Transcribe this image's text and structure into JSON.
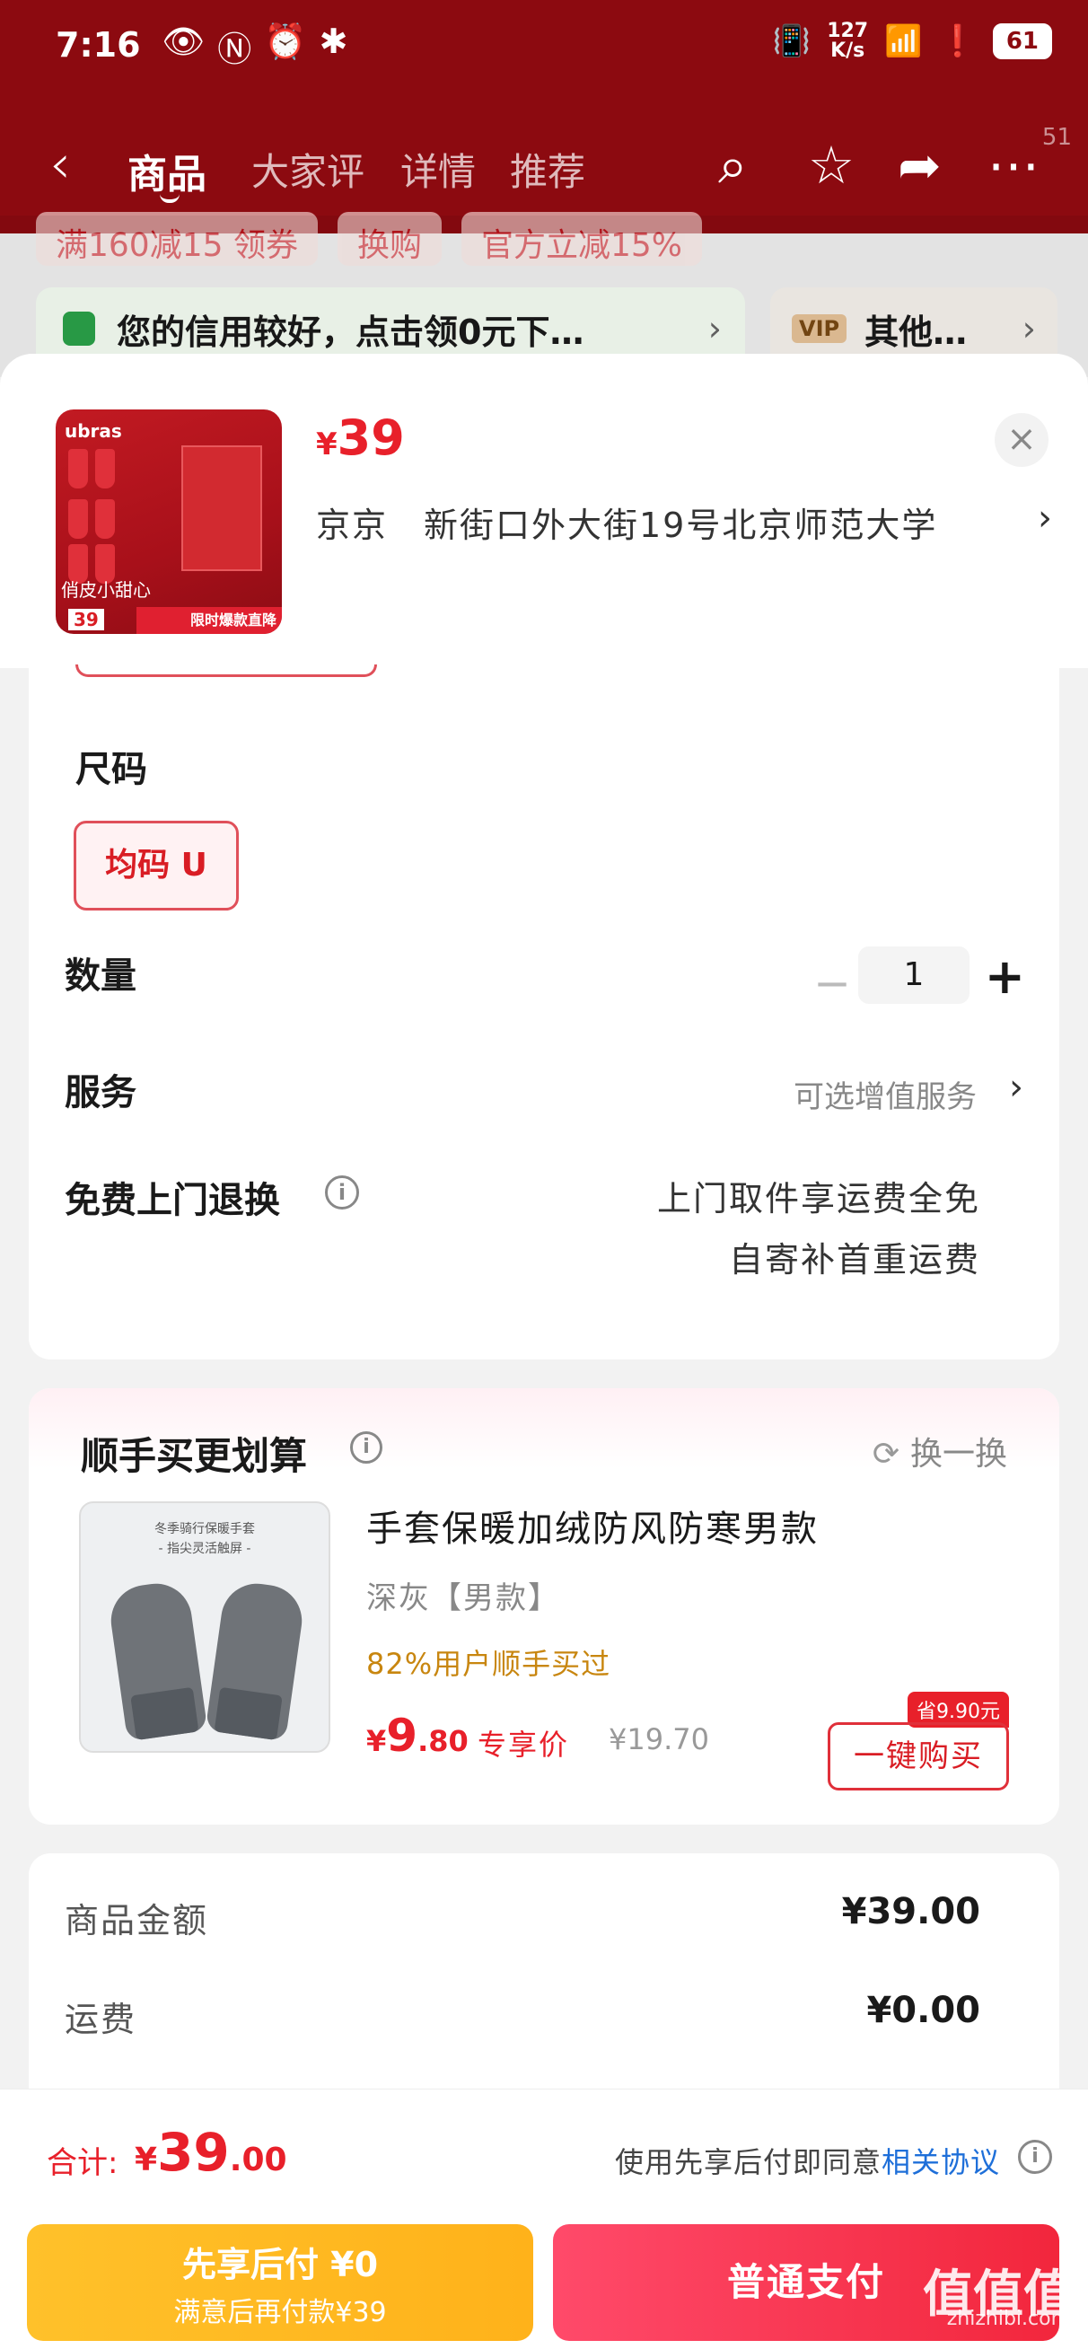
{
  "status_bar": {
    "time": "7:16",
    "network_speed_value": "127",
    "network_speed_unit": "K/s",
    "battery": "61"
  },
  "nav": {
    "tabs": [
      {
        "label": "商品",
        "active": true
      },
      {
        "label": "大家评"
      },
      {
        "label": "详情"
      },
      {
        "label": "推荐"
      }
    ],
    "badge": "51"
  },
  "promo_tags": [
    "满160减15 领券",
    "换购",
    "官方立减15%"
  ],
  "credit_banner": "您的信用较好，点击领0元下…",
  "vip": {
    "badge": "VIP",
    "label": "其他…"
  },
  "sheet": {
    "price_symbol": "¥",
    "price": "39",
    "address": "京京　新街口外大街19号北京师范大学",
    "thumbnail": {
      "brand": "ubras",
      "label": "俏皮小甜心",
      "price": "39",
      "strip": "限时爆款直降"
    }
  },
  "spec": {
    "size_title": "尺码",
    "size_option": "均码 U",
    "qty_label": "数量",
    "qty_value": "1",
    "service_label": "服务",
    "service_hint": "可选增值服务",
    "return_label": "免费上门退换",
    "return_lines": [
      "上门取件享运费全免",
      "自寄补首重运费"
    ]
  },
  "bundle": {
    "title": "顺手买更划算",
    "swap": "换一换",
    "image_caption_1": "冬季骑行保暖手套",
    "image_caption_2": "- 指尖灵活触屏 -",
    "name": "手套保暖加绒防风防寒男款",
    "variant": "深灰【男款】",
    "social_proof": "82%用户顺手买过",
    "price_symbol": "¥",
    "price_int": "9",
    "price_dec": ".80",
    "price_tag": "专享价",
    "orig_price": "¥19.70",
    "save_badge": "省9.90元",
    "buy_label": "一键购买"
  },
  "summary": {
    "items": [
      {
        "label": "商品金额",
        "value": "¥39.00"
      },
      {
        "label": "运费",
        "value": "¥0.00"
      }
    ]
  },
  "bottom": {
    "total_label": "合计:",
    "total_symbol": "¥",
    "total_int": "39",
    "total_dec": ".00",
    "agree_text": "使用先享后付即同意",
    "agree_link": "相关协议",
    "later_line1": "先享后付 ¥0",
    "later_line2": "满意后再付款¥39",
    "pay_label": "普通支付"
  },
  "watermark": {
    "logo": "值值值",
    "text": "zhizhibi.com"
  }
}
